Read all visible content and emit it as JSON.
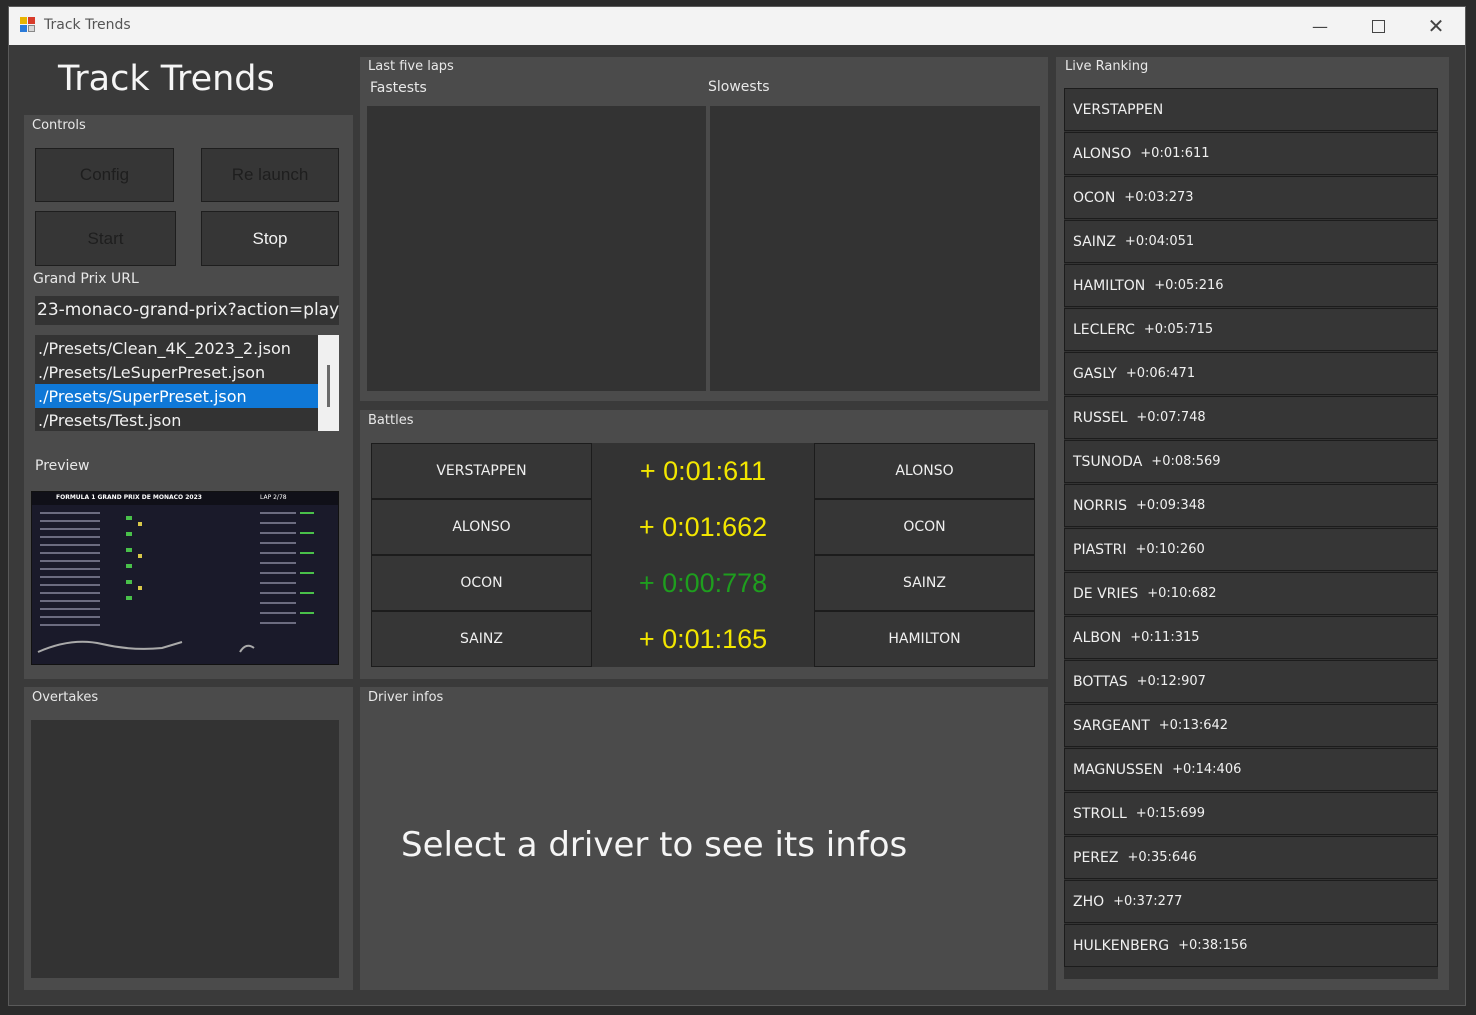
{
  "window": {
    "title": "Track Trends"
  },
  "app": {
    "heading": "Track Trends"
  },
  "controls": {
    "label": "Controls",
    "config_label": "Config",
    "relaunch_label": "Re launch",
    "start_label": "Start",
    "stop_label": "Stop",
    "url_label": "Grand Prix URL",
    "url_value": "23-monaco-grand-prix?action=play",
    "presets": [
      "./Presets/Clean_4K_2023_2.json",
      "./Presets/LeSuperPreset.json",
      "./Presets/SuperPreset.json",
      "./Presets/Test.json"
    ],
    "selected_preset": 2
  },
  "preview": {
    "label": "Preview",
    "thumb_title": "FORMULA 1 GRAND PRIX DE MONACO 2023",
    "thumb_tag": "LAP 2/78"
  },
  "overtakes": {
    "label": "Overtakes"
  },
  "last_laps": {
    "label": "Last five laps",
    "fastest_label": "Fastests",
    "slowest_label": "Slowests"
  },
  "battles": {
    "label": "Battles",
    "rows": [
      {
        "ahead": "VERSTAPPEN",
        "gap": "+ 0:01:611",
        "behind": "ALONSO",
        "color": "#f2e600"
      },
      {
        "ahead": "ALONSO",
        "gap": "+ 0:01:662",
        "behind": "OCON",
        "color": "#f2e600"
      },
      {
        "ahead": "OCON",
        "gap": "+ 0:00:778",
        "behind": "SAINZ",
        "color": "#1e9e1e"
      },
      {
        "ahead": "SAINZ",
        "gap": "+ 0:01:165",
        "behind": "HAMILTON",
        "color": "#f2e600"
      }
    ]
  },
  "driver_infos": {
    "label": "Driver infos",
    "placeholder": "Select a driver to see its infos"
  },
  "live_ranking": {
    "label": "Live Ranking",
    "rows": [
      {
        "name": "VERSTAPPEN",
        "gap": ""
      },
      {
        "name": "ALONSO",
        "gap": "+0:01:611"
      },
      {
        "name": "OCON",
        "gap": "+0:03:273"
      },
      {
        "name": "SAINZ",
        "gap": "+0:04:051"
      },
      {
        "name": "HAMILTON",
        "gap": "+0:05:216"
      },
      {
        "name": "LECLERC",
        "gap": "+0:05:715"
      },
      {
        "name": "GASLY",
        "gap": "+0:06:471"
      },
      {
        "name": "RUSSEL",
        "gap": "+0:07:748"
      },
      {
        "name": "TSUNODA",
        "gap": "+0:08:569"
      },
      {
        "name": "NORRIS",
        "gap": "+0:09:348"
      },
      {
        "name": "PIASTRI",
        "gap": "+0:10:260"
      },
      {
        "name": "DE VRIES",
        "gap": "+0:10:682"
      },
      {
        "name": "ALBON",
        "gap": "+0:11:315"
      },
      {
        "name": "BOTTAS",
        "gap": "+0:12:907"
      },
      {
        "name": "SARGEANT",
        "gap": "+0:13:642"
      },
      {
        "name": "MAGNUSSEN",
        "gap": "+0:14:406"
      },
      {
        "name": "STROLL",
        "gap": "+0:15:699"
      },
      {
        "name": "PEREZ",
        "gap": "+0:35:646"
      },
      {
        "name": "ZHO",
        "gap": "+0:37:277"
      },
      {
        "name": "HULKENBERG",
        "gap": "+0:38:156"
      }
    ]
  }
}
